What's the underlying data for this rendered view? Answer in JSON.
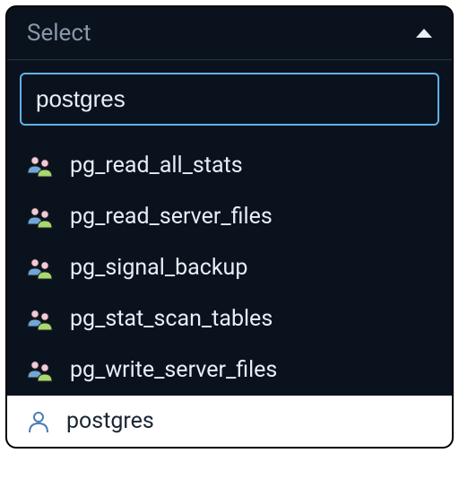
{
  "select": {
    "placeholder": "Select",
    "search_value": "postgres",
    "options": [
      {
        "label": "pg_read_all_stats",
        "type": "role"
      },
      {
        "label": "pg_read_server_files",
        "type": "role"
      },
      {
        "label": "pg_signal_backup",
        "type": "role"
      },
      {
        "label": "pg_stat_scan_tables",
        "type": "role"
      },
      {
        "label": "pg_write_server_files",
        "type": "role"
      },
      {
        "label": "postgres",
        "type": "user"
      }
    ]
  }
}
